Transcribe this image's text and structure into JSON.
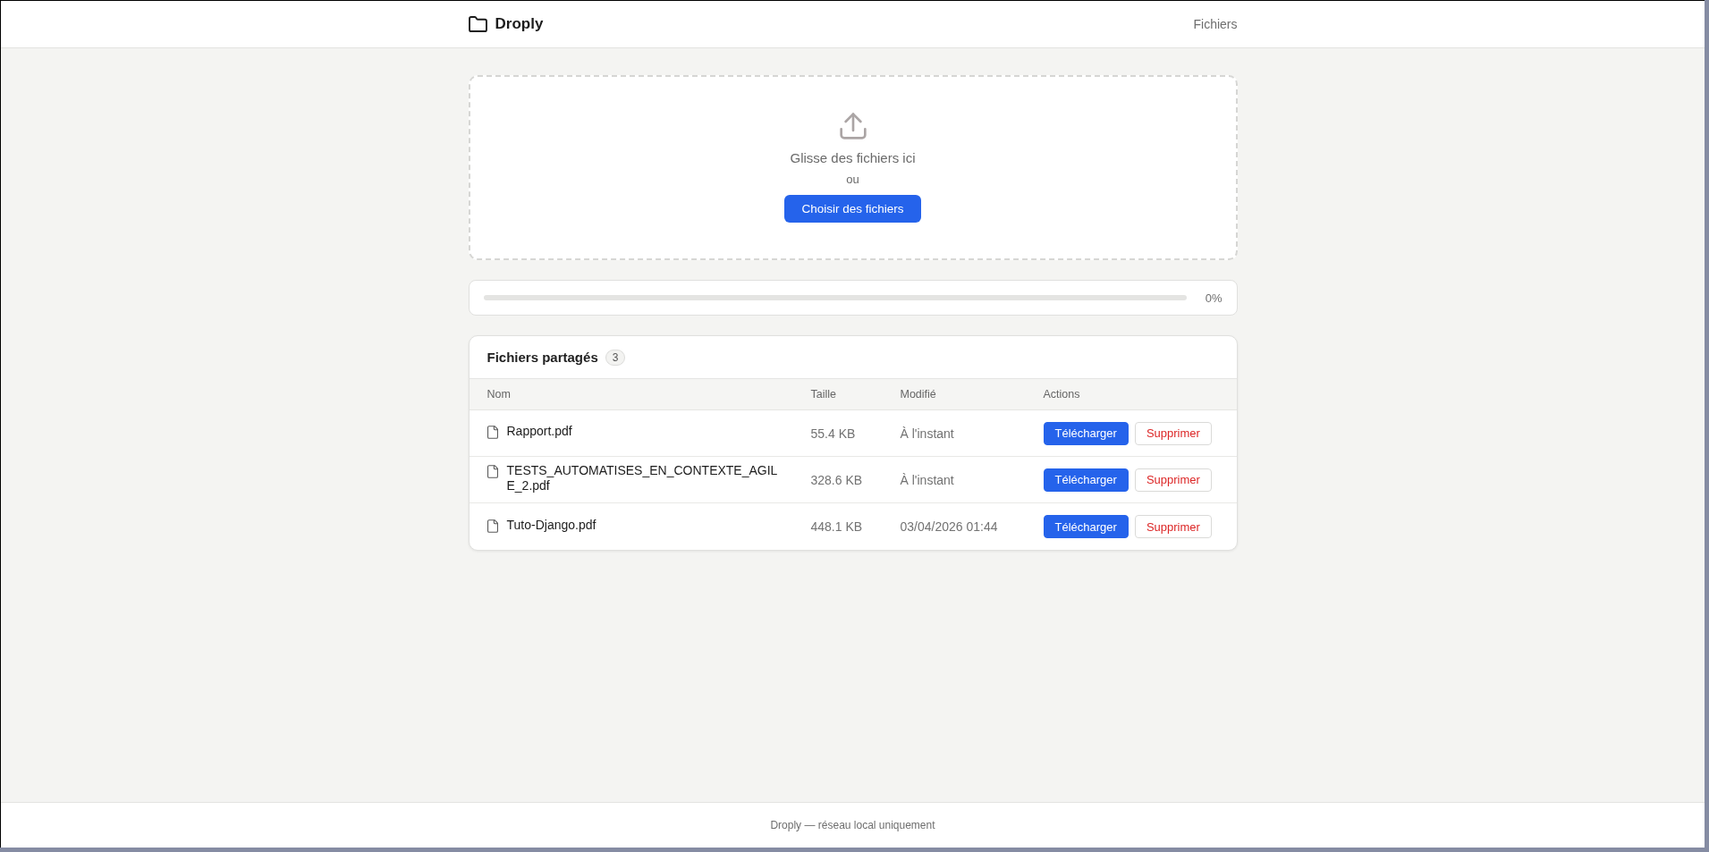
{
  "header": {
    "brand": "Droply",
    "nav": {
      "label": "Fichiers"
    }
  },
  "upload": {
    "title": "Glisse des fichiers ici",
    "separator": "ou",
    "button": "Choisir des fichiers"
  },
  "progress": {
    "reading": "0%"
  },
  "files": {
    "title": "Fichiers partagés",
    "count": "3",
    "columns": [
      "Nom",
      "Taille",
      "Modifié",
      "Actions"
    ],
    "rows": [
      {
        "name": "Rapport.pdf",
        "size": "55.4 KB",
        "modified": "À l'instant",
        "actions": [
          {
            "label": "Télécharger",
            "kind": "primary"
          },
          {
            "label": "Supprimer",
            "kind": "danger"
          }
        ]
      },
      {
        "name": "TESTS_AUTOMATISES_EN_CONTEXTE_AGILE_2.pdf",
        "size": "328.6 KB",
        "modified": "À l'instant",
        "actions": [
          {
            "label": "Télécharger",
            "kind": "primary"
          },
          {
            "label": "Supprimer",
            "kind": "danger"
          }
        ]
      },
      {
        "name": "Tuto-Django.pdf",
        "size": "448.1 KB",
        "modified": "03/04/2026 01:44",
        "actions": [
          {
            "label": "Télécharger",
            "kind": "primary"
          },
          {
            "label": "Supprimer",
            "kind": "danger"
          }
        ]
      }
    ]
  },
  "footer": {
    "text": "Droply — réseau local uniquement"
  }
}
